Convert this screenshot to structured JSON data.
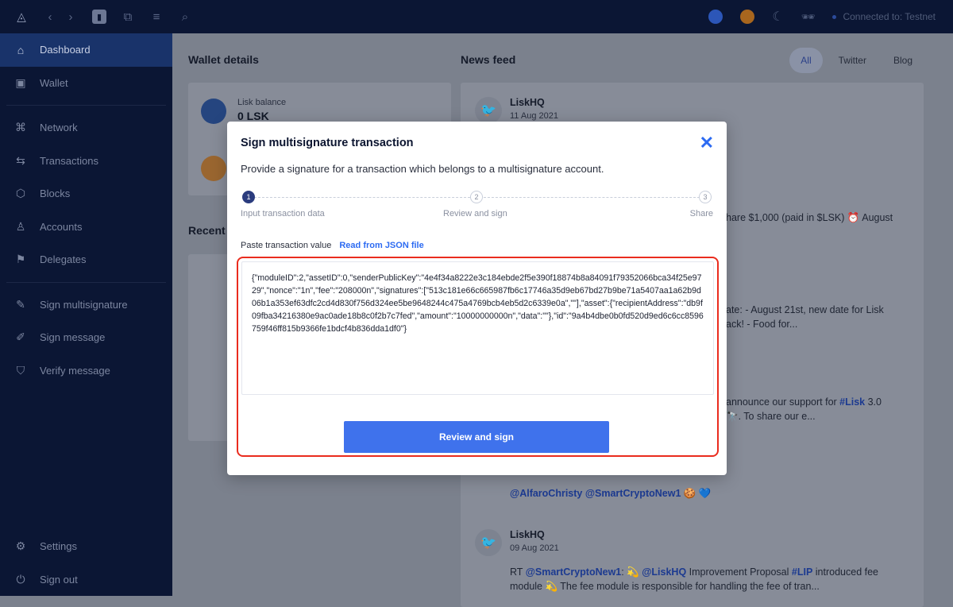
{
  "topbar": {
    "connection": "Connected to: Testnet",
    "icons": [
      "lisk-logo-icon",
      "back-icon",
      "forward-icon",
      "bookmark-icon",
      "copy-icon",
      "queue-icon",
      "search-icon",
      "lisk-account-icon",
      "bitcoin-account-icon",
      "moon-icon",
      "incognito-icon"
    ]
  },
  "sidebar": {
    "items": [
      {
        "label": "Dashboard",
        "icon": "home-icon"
      },
      {
        "label": "Wallet",
        "icon": "wallet-icon"
      },
      {
        "label": "Network",
        "icon": "network-icon"
      },
      {
        "label": "Transactions",
        "icon": "transactions-icon"
      },
      {
        "label": "Blocks",
        "icon": "blocks-icon"
      },
      {
        "label": "Accounts",
        "icon": "accounts-icon"
      },
      {
        "label": "Delegates",
        "icon": "delegates-icon"
      },
      {
        "label": "Sign multisignature",
        "icon": "multisig-icon"
      },
      {
        "label": "Sign message",
        "icon": "sign-icon"
      },
      {
        "label": "Verify message",
        "icon": "verify-icon"
      },
      {
        "label": "Settings",
        "icon": "gear-icon"
      },
      {
        "label": "Sign out",
        "icon": "power-icon"
      }
    ]
  },
  "wallet": {
    "title": "Wallet details",
    "balance_label": "Lisk balance",
    "balance": "0 LSK",
    "recent": "Recent"
  },
  "news": {
    "title": "News feed",
    "tabs": [
      "All",
      "Twitter",
      "Blog"
    ],
    "posts": [
      {
        "author": "LiskHQ",
        "date": "11 Aug 2021"
      },
      {
        "text": "hare $1,000 (paid in $LSK) ⏰  August"
      },
      {
        "text1": "ate: - August 21st, new date for Lisk",
        "text2": "ack! - Food for..."
      },
      {
        "text1": "announce our support for ",
        "tag": "#Lisk",
        "text1b": " 3.0",
        "text2": "🔭. To share our e..."
      },
      {
        "mentions": "@AlfaroChristy @SmartCryptoNew1 🍪 💙"
      },
      {
        "author": "LiskHQ",
        "date": "09 Aug 2021",
        "pre": "RT ",
        "m1": "@SmartCryptoNew1",
        "mid": ": 💫  ",
        "m2": "@LiskHQ",
        "t": " Improvement Proposal ",
        "m3": "#LIP",
        "t2": " introduced fee",
        "line2": "module 💫 The fee module is responsible for handling the fee of tran..."
      }
    ]
  },
  "modal": {
    "title": "Sign multisignature transaction",
    "description": "Provide a signature for a transaction which belongs to a multisignature account.",
    "steps": [
      {
        "n": "1",
        "label": "Input transaction data"
      },
      {
        "n": "2",
        "label": "Review and sign"
      },
      {
        "n": "3",
        "label": "Share"
      }
    ],
    "current_step": 1,
    "paste_label": "Paste transaction value",
    "read_json": "Read from JSON file",
    "value": "{\"moduleID\":2,\"assetID\":0,\"senderPublicKey\":\"4e4f34a8222e3c184ebde2f5e390f18874b8a84091f79352066bca34f25e9729\",\"nonce\":\"1n\",\"fee\":\"208000n\",\"signatures\":[\"513c181e66c665987fb6c17746a35d9eb67bd27b9be71a5407aa1a62b9d06b1a353ef63dfc2cd4d830f756d324ee5be9648244c475a4769bcb4eb5d2c6339e0a\",\"\"],\"asset\":{\"recipientAddress\":\"db9f09fba34216380e9ac0ade18b8c0f2b7c7fed\",\"amount\":\"10000000000n\",\"data\":\"\"},\"id\":\"9a4b4dbe0b0fd520d9ed6c6cc8596759f46ff815b9366fe1bdcf4b836dda1df0\"}",
    "submit": "Review and sign"
  },
  "colors": {
    "accent": "#3f72ec",
    "highlight": "#ea2c1e",
    "sidebar": "#0b1634"
  }
}
